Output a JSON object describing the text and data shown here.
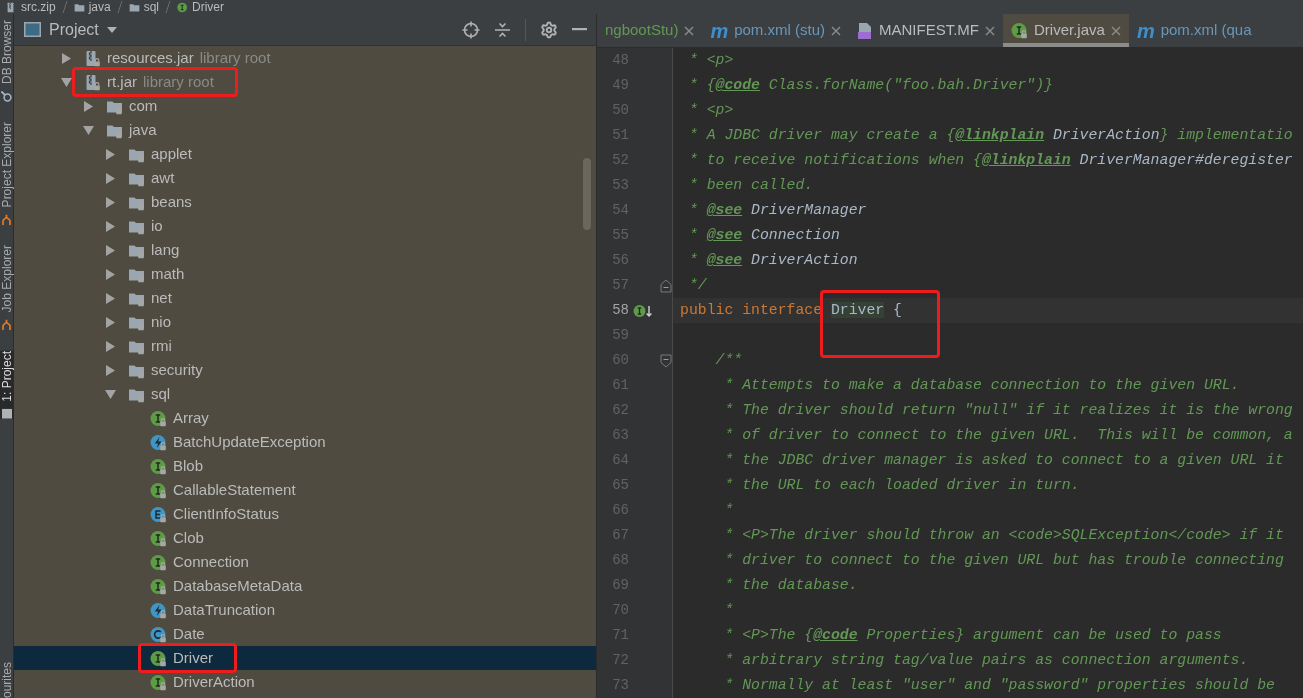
{
  "breadcrumb": [
    {
      "label": "src.zip",
      "kind": "archive"
    },
    {
      "label": "java",
      "kind": "package"
    },
    {
      "label": "sql",
      "kind": "package"
    },
    {
      "label": "Driver",
      "kind": "interface"
    }
  ],
  "tool_strip": {
    "top": [
      {
        "label": "DB Browser",
        "kind": "db",
        "selected": false
      },
      {
        "label": "Project Explorer",
        "kind": "explorer",
        "selected": false
      },
      {
        "label": "Job Explorer",
        "kind": "explorer",
        "selected": false
      },
      {
        "label": "1: Project",
        "kind": "project",
        "selected": true
      }
    ],
    "bottom": [
      {
        "label": "ourites",
        "selected": false
      }
    ]
  },
  "project_view": {
    "title": "Project"
  },
  "project_tree": {
    "items": [
      {
        "label": "resources.jar",
        "suffix": "library root",
        "kind": "jar",
        "expanded": false,
        "selected": false,
        "annotated": false
      },
      {
        "label": "rt.jar",
        "suffix": "library root",
        "kind": "jar",
        "expanded": true,
        "selected": false,
        "annotated": true,
        "children": [
          {
            "label": "com",
            "kind": "package",
            "expanded": false,
            "selected": false,
            "annotated": false
          },
          {
            "label": "java",
            "kind": "package",
            "expanded": true,
            "selected": false,
            "annotated": false,
            "children": [
              {
                "label": "applet",
                "kind": "package",
                "expanded": false,
                "selected": false,
                "annotated": false
              },
              {
                "label": "awt",
                "kind": "package",
                "expanded": false,
                "selected": false,
                "annotated": false
              },
              {
                "label": "beans",
                "kind": "package",
                "expanded": false,
                "selected": false,
                "annotated": false
              },
              {
                "label": "io",
                "kind": "package",
                "expanded": false,
                "selected": false,
                "annotated": false
              },
              {
                "label": "lang",
                "kind": "package",
                "expanded": false,
                "selected": false,
                "annotated": false
              },
              {
                "label": "math",
                "kind": "package",
                "expanded": false,
                "selected": false,
                "annotated": false
              },
              {
                "label": "net",
                "kind": "package",
                "expanded": false,
                "selected": false,
                "annotated": false
              },
              {
                "label": "nio",
                "kind": "package",
                "expanded": false,
                "selected": false,
                "annotated": false
              },
              {
                "label": "rmi",
                "kind": "package",
                "expanded": false,
                "selected": false,
                "annotated": false
              },
              {
                "label": "security",
                "kind": "package",
                "expanded": false,
                "selected": false,
                "annotated": false
              },
              {
                "label": "sql",
                "kind": "package",
                "expanded": true,
                "selected": false,
                "annotated": false,
                "children": [
                  {
                    "label": "Array",
                    "kind": "interface",
                    "selected": false,
                    "annotated": false
                  },
                  {
                    "label": "BatchUpdateException",
                    "kind": "exception",
                    "selected": false,
                    "annotated": false
                  },
                  {
                    "label": "Blob",
                    "kind": "interface",
                    "selected": false,
                    "annotated": false
                  },
                  {
                    "label": "CallableStatement",
                    "kind": "interface",
                    "selected": false,
                    "annotated": false
                  },
                  {
                    "label": "ClientInfoStatus",
                    "kind": "enum",
                    "selected": false,
                    "annotated": false
                  },
                  {
                    "label": "Clob",
                    "kind": "interface",
                    "selected": false,
                    "annotated": false
                  },
                  {
                    "label": "Connection",
                    "kind": "interface",
                    "selected": false,
                    "annotated": false
                  },
                  {
                    "label": "DatabaseMetaData",
                    "kind": "interface",
                    "selected": false,
                    "annotated": false
                  },
                  {
                    "label": "DataTruncation",
                    "kind": "exception",
                    "selected": false,
                    "annotated": false
                  },
                  {
                    "label": "Date",
                    "kind": "class",
                    "selected": false,
                    "annotated": false
                  },
                  {
                    "label": "Driver",
                    "kind": "interface",
                    "selected": true,
                    "annotated": true
                  },
                  {
                    "label": "DriverAction",
                    "kind": "interface",
                    "selected": false,
                    "annotated": false
                  }
                ]
              }
            ]
          }
        ]
      }
    ]
  },
  "editor_tabs": [
    {
      "label": "ngbootStu)",
      "kind": "other",
      "color": "#629755",
      "selected": false,
      "closable": true
    },
    {
      "label": "pom.xml (stu)",
      "kind": "pom",
      "icon_text": "m",
      "color": "#6897bb",
      "selected": false,
      "closable": true
    },
    {
      "label": "MANIFEST.MF",
      "kind": "manifest",
      "color": "#bbbbbb",
      "selected": false,
      "closable": true
    },
    {
      "label": "Driver.java",
      "kind": "interface",
      "color": "#bbbbbb",
      "selected": true,
      "closable": true
    },
    {
      "label": "pom.xml (qua",
      "kind": "pom",
      "icon_text": "m",
      "color": "#6897bb",
      "selected": false,
      "closable": false
    }
  ],
  "code_lines": [
    {
      "number": "48",
      "current": false,
      "annotated": false,
      "segments": [
        {
          "text": " * <p>",
          "kind": "doc"
        }
      ]
    },
    {
      "number": "49",
      "current": false,
      "annotated": false,
      "segments": [
        {
          "text": " * {",
          "kind": "doc"
        },
        {
          "text": "@code",
          "kind": "doc-tag"
        },
        {
          "text": " Class.forName(\"foo.bah.Driver\")}",
          "kind": "doc"
        }
      ]
    },
    {
      "number": "50",
      "current": false,
      "annotated": false,
      "segments": [
        {
          "text": " * <p>",
          "kind": "doc"
        }
      ]
    },
    {
      "number": "51",
      "current": false,
      "annotated": false,
      "segments": [
        {
          "text": " * A JDBC driver may create a {",
          "kind": "doc"
        },
        {
          "text": "@linkplain",
          "kind": "doc-tag"
        },
        {
          "text": " DriverAction",
          "kind": "doc-ref"
        },
        {
          "text": "} implementatio",
          "kind": "doc"
        }
      ]
    },
    {
      "number": "52",
      "current": false,
      "annotated": false,
      "segments": [
        {
          "text": " * to receive notifications when {",
          "kind": "doc"
        },
        {
          "text": "@linkplain",
          "kind": "doc-tag"
        },
        {
          "text": " DriverManager#deregister",
          "kind": "doc-ref"
        }
      ]
    },
    {
      "number": "53",
      "current": false,
      "annotated": false,
      "segments": [
        {
          "text": " * been called.",
          "kind": "doc"
        }
      ]
    },
    {
      "number": "54",
      "current": false,
      "annotated": false,
      "segments": [
        {
          "text": " * ",
          "kind": "doc"
        },
        {
          "text": "@see",
          "kind": "doc-tag"
        },
        {
          "text": " DriverManager",
          "kind": "doc-ref"
        }
      ]
    },
    {
      "number": "55",
      "current": false,
      "annotated": false,
      "segments": [
        {
          "text": " * ",
          "kind": "doc"
        },
        {
          "text": "@see",
          "kind": "doc-tag"
        },
        {
          "text": " Connection",
          "kind": "doc-ref"
        }
      ]
    },
    {
      "number": "56",
      "current": false,
      "annotated": false,
      "segments": [
        {
          "text": " * ",
          "kind": "doc"
        },
        {
          "text": "@see",
          "kind": "doc-tag"
        },
        {
          "text": " DriverAction",
          "kind": "doc-ref"
        }
      ]
    },
    {
      "number": "57",
      "current": false,
      "annotated": false,
      "fold": {
        "kind": "end"
      },
      "segments": [
        {
          "text": " */",
          "kind": "doc"
        }
      ]
    },
    {
      "number": "58",
      "current": true,
      "annotated": true,
      "gutter_icon": {
        "kind": "implemented"
      },
      "segments": [
        {
          "text": "public interface ",
          "kind": "keyword"
        },
        {
          "text": "Driver",
          "kind": "highlighted-ident"
        },
        {
          "text": " {",
          "kind": "plain"
        }
      ]
    },
    {
      "number": "59",
      "current": false,
      "annotated": false
    },
    {
      "number": "60",
      "current": false,
      "annotated": false,
      "fold": {
        "kind": "start"
      },
      "segments": [
        {
          "text": "    /**",
          "kind": "doc"
        }
      ]
    },
    {
      "number": "61",
      "current": false,
      "annotated": false,
      "segments": [
        {
          "text": "     * Attempts to make a database connection to the given URL.",
          "kind": "doc"
        }
      ]
    },
    {
      "number": "62",
      "current": false,
      "annotated": false,
      "segments": [
        {
          "text": "     * The driver should return \"null\" if it realizes it is the wrong",
          "kind": "doc"
        }
      ]
    },
    {
      "number": "63",
      "current": false,
      "annotated": false,
      "segments": [
        {
          "text": "     * of driver to connect to the given URL.  This will be common, a",
          "kind": "doc"
        }
      ]
    },
    {
      "number": "64",
      "current": false,
      "annotated": false,
      "segments": [
        {
          "text": "     * the JDBC driver manager is asked to connect to a given URL it",
          "kind": "doc"
        }
      ]
    },
    {
      "number": "65",
      "current": false,
      "annotated": false,
      "segments": [
        {
          "text": "     * the URL to each loaded driver in turn.",
          "kind": "doc"
        }
      ]
    },
    {
      "number": "66",
      "current": false,
      "annotated": false,
      "segments": [
        {
          "text": "     *",
          "kind": "doc"
        }
      ]
    },
    {
      "number": "67",
      "current": false,
      "annotated": false,
      "segments": [
        {
          "text": "     * <P>The driver should throw an <code>SQLException</code> if it",
          "kind": "doc"
        }
      ]
    },
    {
      "number": "68",
      "current": false,
      "annotated": false,
      "segments": [
        {
          "text": "     * driver to connect to the given URL but has trouble connecting",
          "kind": "doc"
        }
      ]
    },
    {
      "number": "69",
      "current": false,
      "annotated": false,
      "segments": [
        {
          "text": "     * the database.",
          "kind": "doc"
        }
      ]
    },
    {
      "number": "70",
      "current": false,
      "annotated": false,
      "segments": [
        {
          "text": "     *",
          "kind": "doc"
        }
      ]
    },
    {
      "number": "71",
      "current": false,
      "annotated": false,
      "segments": [
        {
          "text": "     * <P>The {",
          "kind": "doc"
        },
        {
          "text": "@code",
          "kind": "doc-tag"
        },
        {
          "text": " Properties} argument can be used to pass",
          "kind": "doc"
        }
      ]
    },
    {
      "number": "72",
      "current": false,
      "annotated": false,
      "segments": [
        {
          "text": "     * arbitrary string tag/value pairs as connection arguments.",
          "kind": "doc"
        }
      ]
    },
    {
      "number": "73",
      "current": false,
      "annotated": false,
      "segments": [
        {
          "text": "     * Normally at least \"user\" and \"password\" properties should be",
          "kind": "doc"
        }
      ]
    }
  ]
}
